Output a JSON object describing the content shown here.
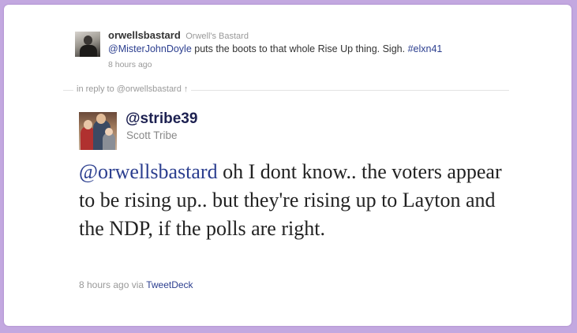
{
  "parent_tweet": {
    "username": "orwellsbastard",
    "display_name": "Orwell's Bastard",
    "mention": "@MisterJohnDoyle",
    "text_rest": " puts the boots to that whole Rise Up thing. Sigh. ",
    "hashtag": "#elxn41",
    "time": "8 hours ago"
  },
  "reply_context": {
    "prefix": "in reply to ",
    "user": "@orwellsbastard",
    "arrow": "↑"
  },
  "main_tweet": {
    "handle": "@stribe39",
    "display_name": "Scott Tribe",
    "mention": "@orwellsbastard",
    "text_rest": " oh I dont know.. the voters appear to be rising up.. but they're rising up to Layton and the NDP, if the polls are right.",
    "time": "8 hours ago",
    "via_prefix": " via ",
    "source": "TweetDeck"
  },
  "colors": {
    "page_background": "#c3a8e0",
    "link": "#2b3e8f",
    "handle": "#1d2151",
    "muted": "#999999"
  }
}
